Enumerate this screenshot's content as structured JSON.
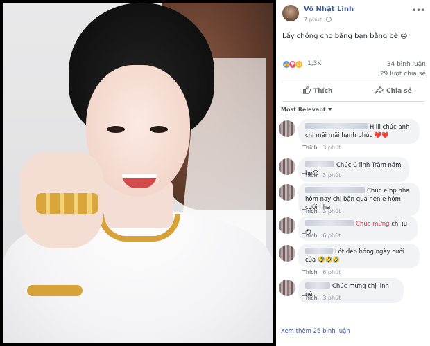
{
  "post": {
    "author": "Võ Nhật Linh",
    "time": "7 phút",
    "text": "Lấy chồng cho bằng bạn bằng bè 😜",
    "reactions_count": "1,3K",
    "comments_count": "34 bình luận",
    "shares_count": "29 lượt chia sẻ"
  },
  "actions": {
    "like_label": "Thích",
    "share_label": "Chia sẻ"
  },
  "comments_filter": "Most Relevant",
  "comments": [
    {
      "text": "Hiiii chúc anh chị mãi mãi hạnh phúc ❤️❤️",
      "like": "Thích",
      "time": "3 phút"
    },
    {
      "text": "Chúc C linh Trăm năm hp😍",
      "like": "Thích",
      "time": "3 phút"
    },
    {
      "text": "Chúc e hp nha hôm nay chị bận quá hẹn e hôm cưới nha",
      "like": "Thích",
      "time": "3 phút"
    },
    {
      "text_red": "Chúc mừng",
      "text": " chị iu 😍",
      "like": "Thích",
      "time": "6 phút"
    },
    {
      "text": "Lót dép hóng ngày cưới của 🤣🤣🤣",
      "like": "Thích",
      "time": "6 phút"
    },
    {
      "text": "Chúc mừng chị linh nè",
      "like": "Thích",
      "time": "3 phút"
    }
  ],
  "more_comments": "Xem thêm 26 bình luận",
  "icons": {
    "globe": "globe-icon",
    "more": "more-options-icon",
    "like": "thumbs-up-icon",
    "share": "share-arrow-icon"
  },
  "colors": {
    "link_blue": "#365899",
    "reaction_like": "#5890ff",
    "reaction_love": "#f25268",
    "reaction_haha": "#f7b125",
    "bubble_bg": "#f2f3f5"
  }
}
